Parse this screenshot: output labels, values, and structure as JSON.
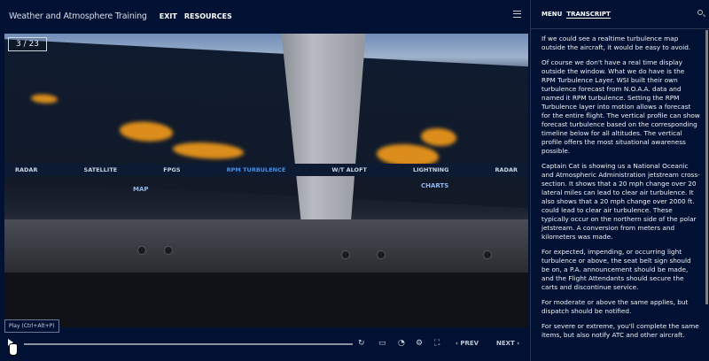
{
  "header": {
    "title": "Weather and Atmosphere Training",
    "nav": [
      "EXIT",
      "RESOURCES"
    ]
  },
  "slide": {
    "counter": "3 / 23",
    "display_tabs": [
      "RADAR",
      "SATELLITE",
      "FPGS",
      "RPM TURBULENCE",
      "W/T ALOFT",
      "LIGHTNING",
      "RADAR"
    ],
    "display_buttons": [
      "MAP",
      "CHARTS"
    ]
  },
  "player": {
    "tooltip": "Play (Ctrl+Alt+P)",
    "progress": 0,
    "prev": "‹ PREV",
    "next": "NEXT ›"
  },
  "sidebar": {
    "tabs": [
      "MENU",
      "TRANSCRIPT"
    ],
    "active_tab": "TRANSCRIPT",
    "transcript": [
      "If we could see a realtime turbulence map outside the aircraft, it would be easy to avoid.",
      "Of course we don't have a real time display outside the window. What we do have is the RPM Turbulence Layer. WSI built their own turbulence forecast from N.O.A.A. data and named it RPM turbulence. Setting the RPM Turbulence layer into motion allows a forecast for the entire flight. The vertical profile can show forecast turbulence based on the corresponding timeline below for all altitudes. The vertical profile offers the most situational awareness possible.",
      "Captain Cat is showing us a National Oceanic and Atmospheric Administration jetstream cross-section. It shows that a 20 mph change over 20 lateral miles can lead to clear air turbulence. It also shows that a 20 mph change over 2000 ft. could lead to clear air turbulence. These typically occur on the northern side of the polar jetstream. A conversion from meters and kilometers was made.",
      "For expected, impending, or occurring light turbulence or above, the seat belt sign should be on, a P.A. announcement should be made, and the Flight Attendants should secure the carts and discontinue service.",
      "For moderate or above the same applies, but dispatch should be notified.",
      "For severe or extreme, you'll complete the same items, but also notify ATC and other aircraft."
    ]
  }
}
